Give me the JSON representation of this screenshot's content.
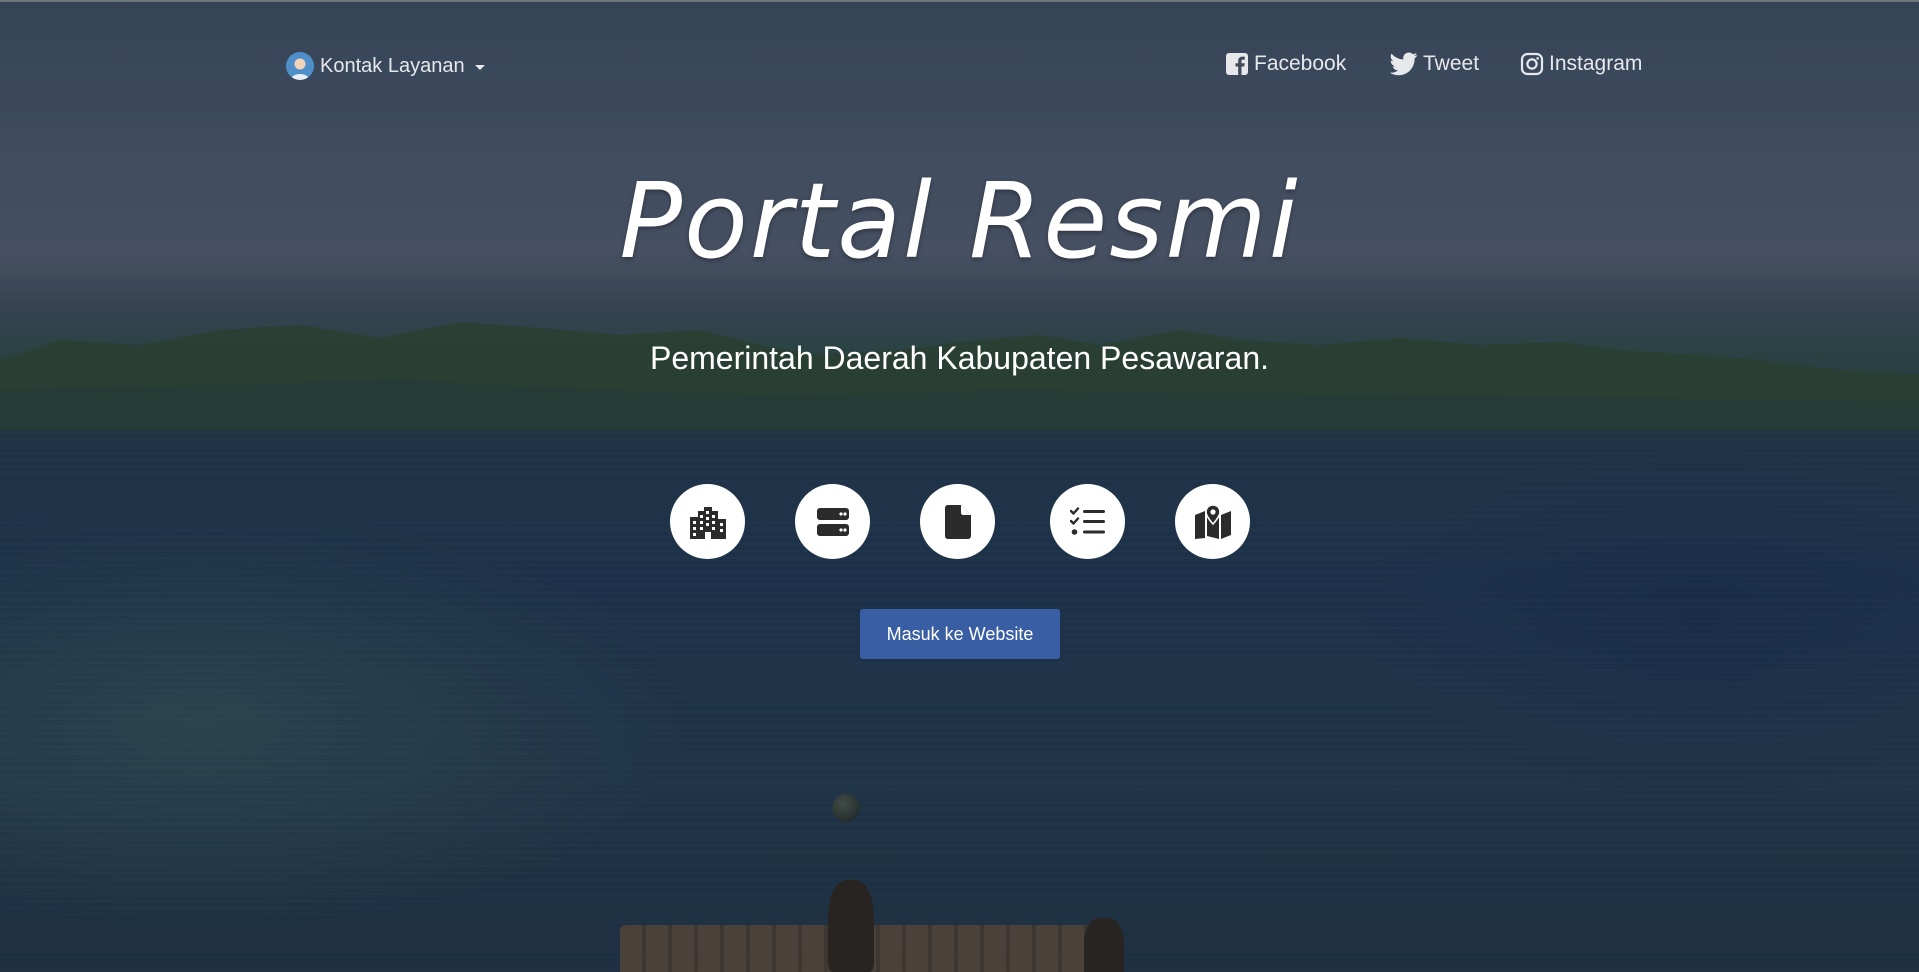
{
  "header": {
    "contact_label": "Kontak Layanan",
    "social": [
      {
        "label": "Facebook",
        "icon": "facebook-icon"
      },
      {
        "label": "Tweet",
        "icon": "twitter-icon"
      },
      {
        "label": "Instagram",
        "icon": "instagram-icon"
      }
    ]
  },
  "hero": {
    "title": "Portal Resmi",
    "subtitle": "Pemerintah Daerah Kabupaten Pesawaran.",
    "quick_links": [
      {
        "icon": "building-icon"
      },
      {
        "icon": "server-icon"
      },
      {
        "icon": "file-icon"
      },
      {
        "icon": "tasks-icon"
      },
      {
        "icon": "map-icon"
      }
    ],
    "cta_label": "Masuk ke Website"
  },
  "colors": {
    "accent": "#3a5ea4",
    "text": "#ffffff",
    "icon": "#2b2b2b"
  }
}
